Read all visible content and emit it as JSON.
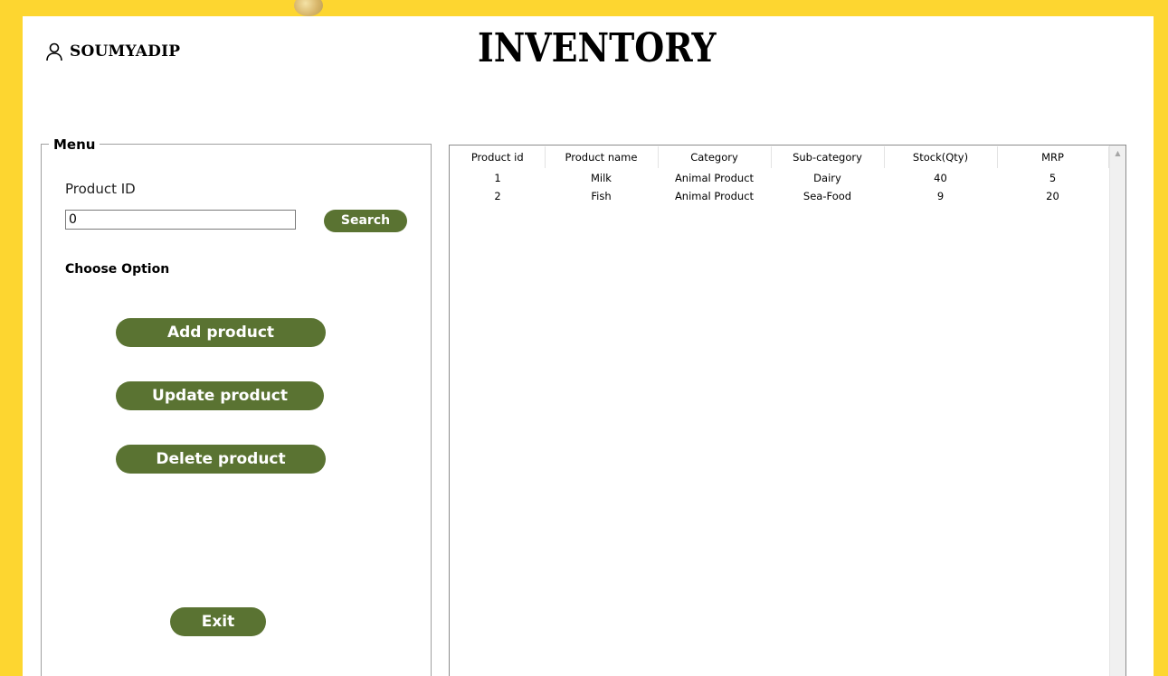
{
  "app": {
    "title": "INVENTORY",
    "user": {
      "name": "SOUMYADIP",
      "icon": "user-icon"
    }
  },
  "menu": {
    "legend": "Menu",
    "product_id_label": "Product ID",
    "product_id_value": "0",
    "search_label": "Search",
    "choose_option_label": "Choose Option",
    "add_label": "Add product",
    "update_label": "Update product",
    "delete_label": "Delete product",
    "exit_label": "Exit"
  },
  "table": {
    "columns": [
      "Product id",
      "Product name",
      "Category",
      "Sub-category",
      "Stock(Qty)",
      "MRP"
    ],
    "rows": [
      [
        "1",
        "Milk",
        "Animal Product",
        "Dairy",
        "40",
        "5"
      ],
      [
        "2",
        "Fish",
        "Animal Product",
        "Sea-Food",
        "9",
        "20"
      ]
    ]
  },
  "colors": {
    "background": "#fdd630",
    "button": "#5a7332",
    "panel": "#ffffff"
  }
}
